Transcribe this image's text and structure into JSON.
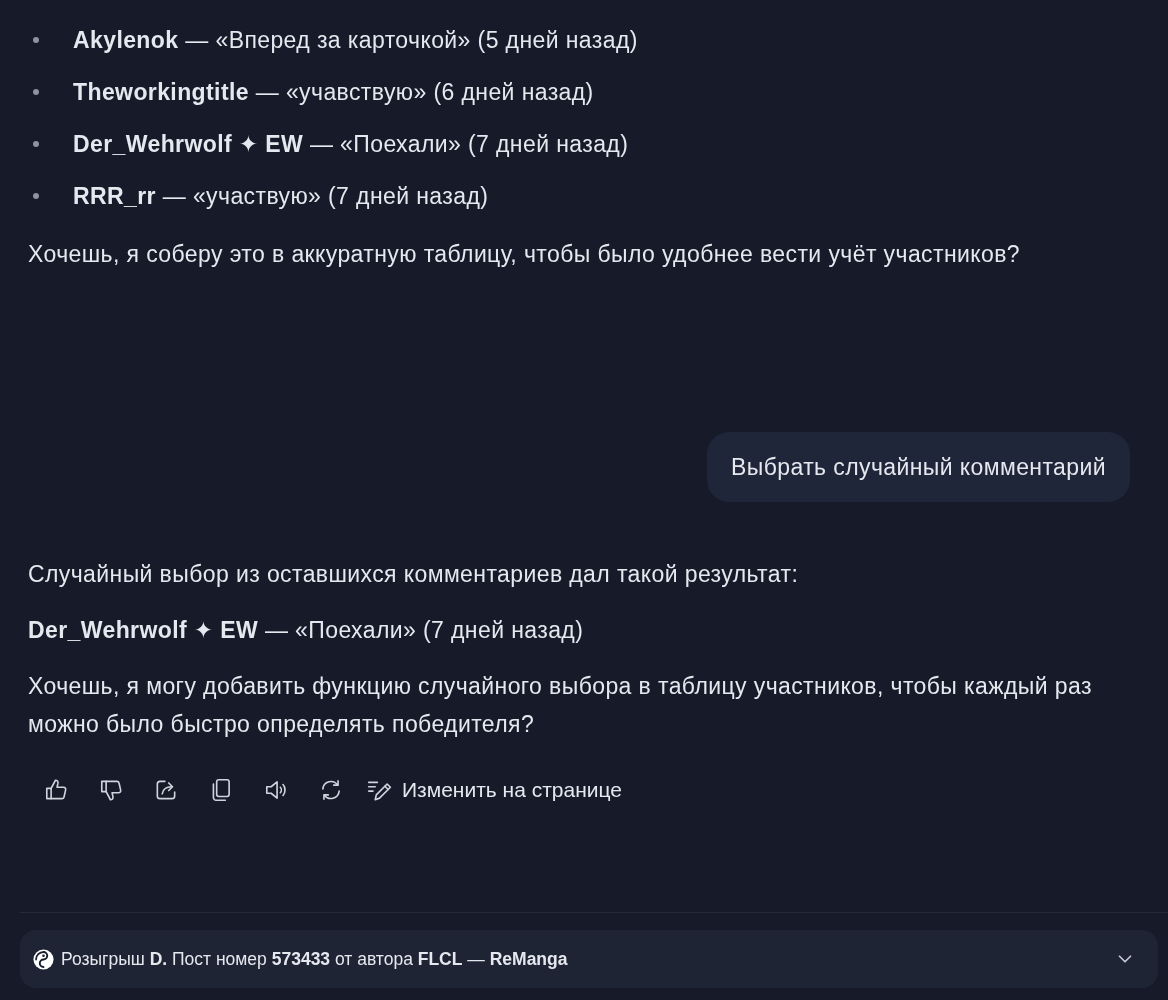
{
  "reply_1": {
    "list_items": [
      {
        "text": "**Akylenok** — «Вперед за карточкой» (5 дней назад)"
      },
      {
        "text": "**Theworkingtitle** — «учавствую» (6 дней назад)"
      },
      {
        "text": "**Der_Wehrwolf ✦ EW** — «Поехали» (7 дней назад)"
      },
      {
        "text": "**RRR_rr** — «участвую» (7 дней назад)"
      }
    ],
    "paragraph": "Хочешь, я соберу это в аккуратную таблицу, чтобы было удобнее вести учёт участников?"
  },
  "user_message": {
    "text": "Выбрать случайный комментарий"
  },
  "reply_2": {
    "paragraphs": [
      "Случайный выбор из оставшихся комментариев дал такой результат:",
      "**Der_Wehrwolf ✦ EW** — «Поехали» (7 дней назад)",
      "Хочешь, я могу добавить функцию случайного выбора в таблицу участников, чтобы каждый раз можно было быстро определять победителя?"
    ]
  },
  "actions": [
    {
      "kind": "like"
    },
    {
      "kind": "dislike"
    },
    {
      "kind": "share"
    },
    {
      "kind": "copy"
    },
    {
      "kind": "read_aloud"
    },
    {
      "kind": "regenerate"
    },
    {
      "kind": "edit",
      "label": "Изменить на странице"
    }
  ],
  "source_panel": {
    "title": "Розыгрыш **D.** Пост номер **573433** от автора **FLCL** — **ReManga**",
    "expanded": false
  }
}
